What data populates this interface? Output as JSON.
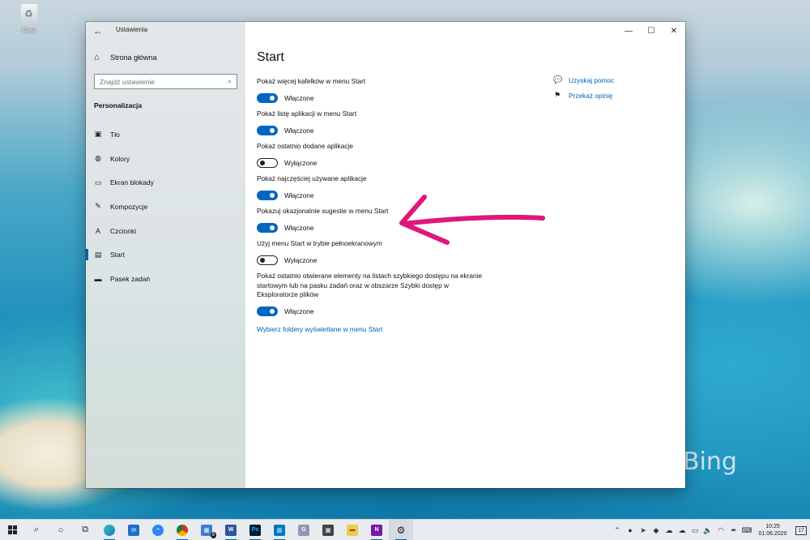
{
  "desktop": {
    "recycle_bin_label": "Kosz",
    "bing_watermark": "Bing"
  },
  "window": {
    "title": "Ustawienia",
    "controls": {
      "minimize": "—",
      "maximize": "☐",
      "close": "✕"
    }
  },
  "sidebar": {
    "home_label": "Strona główna",
    "search_placeholder": "Znajdź ustawienie",
    "section_heading": "Personalizacja",
    "items": [
      {
        "label": "Tło",
        "icon": "picture-icon"
      },
      {
        "label": "Kolory",
        "icon": "palette-icon"
      },
      {
        "label": "Ekran blokady",
        "icon": "lock-screen-icon"
      },
      {
        "label": "Kompozycje",
        "icon": "brush-icon"
      },
      {
        "label": "Czcionki",
        "icon": "font-icon"
      },
      {
        "label": "Start",
        "icon": "start-icon",
        "active": true
      },
      {
        "label": "Pasek zadań",
        "icon": "taskbar-icon"
      }
    ]
  },
  "main": {
    "title": "Start",
    "settings": [
      {
        "label": "Pokaż więcej kafelków w menu Start",
        "state": "Włączone",
        "on": true
      },
      {
        "label": "Pokaż listę aplikacji w menu Start",
        "state": "Włączone",
        "on": true
      },
      {
        "label": "Pokaż ostatnio dodane aplikacje",
        "state": "Wyłączone",
        "on": false
      },
      {
        "label": "Pokaż najczęściej używane aplikacje",
        "state": "Włączone",
        "on": true
      },
      {
        "label": "Pokazuj okazjonalnie sugestie w menu Start",
        "state": "Włączone",
        "on": true
      },
      {
        "label": "Użyj menu Start w trybie pełnoekranowym",
        "state": "Wyłączone",
        "on": false
      },
      {
        "label": "Pokaż ostatnio otwierane elementy na listach szybkiego dostępu na ekranie startowym lub na pasku zadań oraz w obszarze Szybki dostęp w Eksploratorze plików",
        "state": "Włączone",
        "on": true
      }
    ],
    "folders_link": "Wybierz foldery wyświetlane w menu Start",
    "help": {
      "get_help": "Uzyskaj pomoc",
      "feedback": "Przekaż opinię"
    }
  },
  "annotation": {
    "arrow_color": "#e0177a"
  },
  "taskbar": {
    "mail_badge": "8",
    "word_label": "W",
    "photoshop_label": "Ps",
    "onenote_label": "N",
    "time": "10:25",
    "date": "01.06.2020",
    "notification_count": "17"
  },
  "colors": {
    "accent": "#0063b1",
    "toggle_on": "#0067c0"
  }
}
